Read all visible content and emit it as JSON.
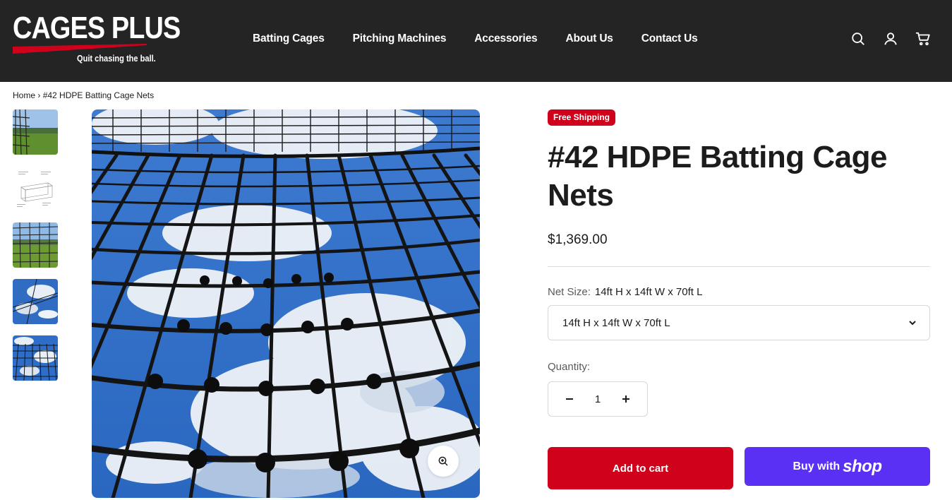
{
  "brand": {
    "logo_text": "CAGES PLUS",
    "tagline": "Quit chasing the ball.",
    "accent_color": "#d0021b"
  },
  "nav": {
    "items": [
      "Batting Cages",
      "Pitching Machines",
      "Accessories",
      "About Us",
      "Contact Us"
    ]
  },
  "header_icons": [
    "search-icon",
    "account-icon",
    "cart-icon"
  ],
  "breadcrumb": {
    "home": "Home",
    "separator": "›",
    "current": "#42 HDPE Batting Cage Nets"
  },
  "gallery": {
    "thumbnails": [
      "net-field-photo",
      "cage-diagram",
      "net-field-photo-2",
      "net-sky-photo",
      "net-sky-closeup"
    ],
    "active_index": 4
  },
  "product": {
    "badge": "Free Shipping",
    "title": "#42 HDPE Batting Cage Nets",
    "price": "$1,369.00",
    "option_label": "Net Size:",
    "option_selected": "14ft H x 14ft W x 70ft L",
    "select_value": "14ft H x 14ft W x 70ft L",
    "quantity_label": "Quantity:",
    "quantity": "1",
    "add_to_cart": "Add to cart",
    "buy_with": "Buy with",
    "shop_word": "shop",
    "shop_color": "#5a31f4"
  }
}
